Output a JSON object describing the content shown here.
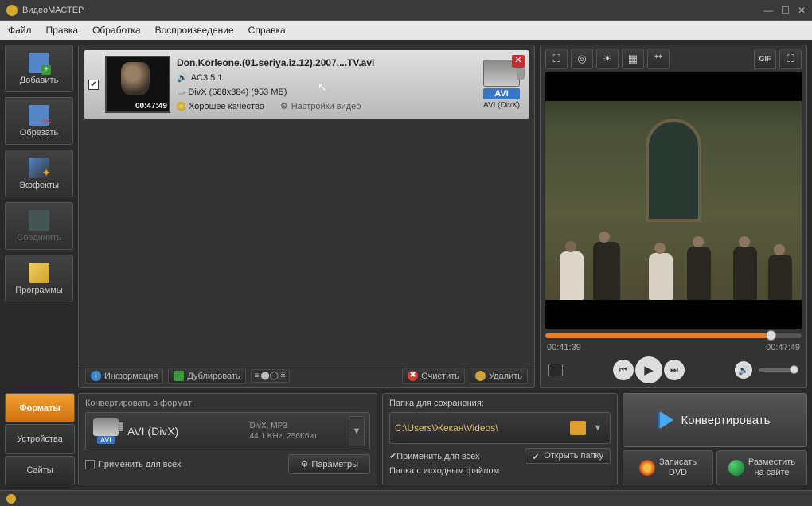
{
  "app": {
    "title": "ВидеоМАСТЕР"
  },
  "menu": {
    "file": "Файл",
    "edit": "Правка",
    "process": "Обработка",
    "playback": "Воспроизведение",
    "help": "Справка"
  },
  "sidebar": {
    "add": "Добавить",
    "cut": "Обрезать",
    "fx": "Эффекты",
    "merge": "Соединить",
    "programs": "Программы"
  },
  "file": {
    "name": "Don.Korleone.(01.seriya.iz.12).2007....TV.avi",
    "audio": "AC3 5.1",
    "video": "DivX (688x384) (953 МБ)",
    "quality": "Хорошее качество",
    "settings": "Настройки видео",
    "thumb_ts": "00:47:49",
    "format_badge": "AVI",
    "format_sub": "AVI (DivX)"
  },
  "toolbar": {
    "info": "Информация",
    "dup": "Дублировать",
    "clear": "Очистить",
    "del": "Удалить"
  },
  "preview": {
    "time_cur": "00:41:39",
    "time_total": "00:47:49"
  },
  "tabs": {
    "formats": "Форматы",
    "devices": "Устройства",
    "sites": "Сайты"
  },
  "format": {
    "hdr": "Конвертировать в формат:",
    "badge": "AVI",
    "name": "AVI (DivX)",
    "line1": "DivX, MP3",
    "line2": "44,1 KHz, 256Кбит",
    "apply_all": "Применить для всех",
    "params": "Параметры"
  },
  "save": {
    "hdr": "Папка для сохранения:",
    "path": "C:\\Users\\Жекан\\Videos\\",
    "apply_all": "Применить для всех",
    "source": "Папка с исходным файлом",
    "open": "Открыть папку"
  },
  "actions": {
    "convert": "Конвертировать",
    "dvd": "Записать\nDVD",
    "site": "Разместить\nна сайте"
  }
}
